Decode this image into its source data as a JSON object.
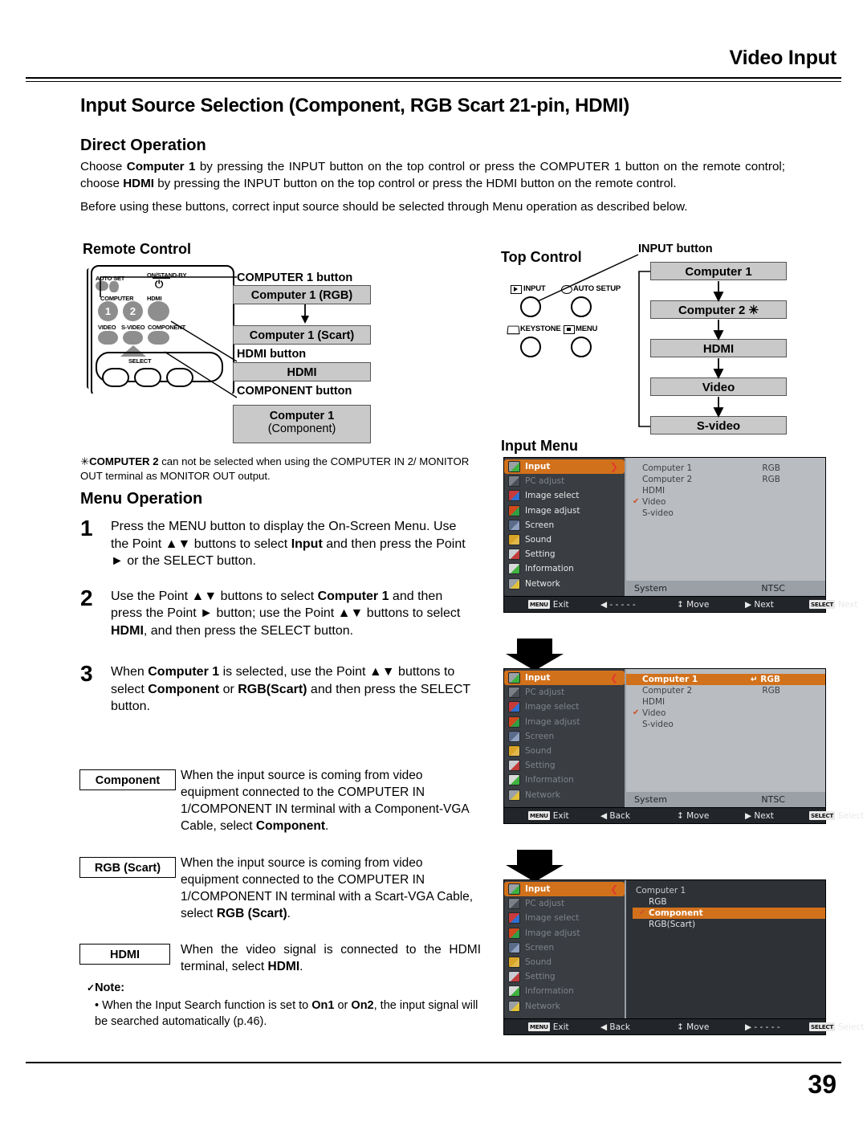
{
  "header": {
    "running_title": "Video Input"
  },
  "section": {
    "title": "Input Source Selection (Component, RGB Scart 21-pin, HDMI)",
    "direct_operation_heading": "Direct Operation",
    "direct_p1_a": "Choose ",
    "direct_p1_b": "Computer 1",
    "direct_p1_c": " by pressing the INPUT button on the top control or press the COMPUTER 1 button on the remote control; choose ",
    "direct_p1_d": "HDMI",
    "direct_p1_e": " by pressing the INPUT button on the top control or press the HDMI button on the remote control.",
    "direct_p2": "Before using these buttons, correct input source should be selected through Menu operation as described below."
  },
  "remote": {
    "heading": "Remote Control",
    "labels": {
      "auto_set": "AUTO SET",
      "on_standby": "ON/STAND-BY",
      "computer": "COMPUTER",
      "hdmi": "HDMI",
      "video": "VIDEO",
      "s_video": "S-VIDEO",
      "component": "COMPONENT",
      "select": "SELECT",
      "btn1": "1",
      "btn2": "2",
      "power_glyph": "⏻"
    },
    "callouts": {
      "computer1_button": "COMPUTER 1 button",
      "hdmi_button": "HDMI button",
      "component_button": "COMPONENT button"
    },
    "boxes": {
      "computer1_rgb": "Computer 1 (RGB)",
      "computer1_scart": "Computer 1 (Scart)",
      "hdmi": "HDMI",
      "computer1_component_line1": "Computer 1",
      "computer1_component_line2": "(Component)"
    }
  },
  "top_control": {
    "heading": "Top Control",
    "input_callout": "INPUT button",
    "buttons": [
      {
        "label": "INPUT"
      },
      {
        "label": "AUTO SETUP"
      },
      {
        "label": "KEYSTONE"
      },
      {
        "label": "MENU"
      }
    ],
    "cycle": [
      "Computer 1",
      "Computer 2 ✳",
      "HDMI",
      "Video",
      "S-video"
    ]
  },
  "footnote": {
    "marker": "✳",
    "bold": "COMPUTER 2",
    "rest": " can not be selected when using the COMPUTER IN 2/ MONITOR OUT terminal as MONITOR OUT output."
  },
  "menu_operation": {
    "heading": "Menu Operation",
    "steps": [
      {
        "num": "1",
        "text_parts": [
          {
            "t": "Press the MENU button to display the On-Screen Menu. Use the Point ▲▼ buttons to select ",
            "b": false
          },
          {
            "t": "Input",
            "b": true
          },
          {
            "t": " and then press the Point ► or the SELECT button.",
            "b": false
          }
        ]
      },
      {
        "num": "2",
        "text_parts": [
          {
            "t": "Use the Point ▲▼ buttons to select ",
            "b": false
          },
          {
            "t": "Computer 1",
            "b": true
          },
          {
            "t": " and then press the Point ► button; use the Point ▲▼ buttons to select ",
            "b": false
          },
          {
            "t": "HDMI",
            "b": true
          },
          {
            "t": ", and then press the SELECT button.",
            "b": false
          }
        ]
      },
      {
        "num": "3",
        "text_parts": [
          {
            "t": "When ",
            "b": false
          },
          {
            "t": "Computer 1",
            "b": true
          },
          {
            "t": " is selected, use the Point ▲▼ buttons to select ",
            "b": false
          },
          {
            "t": "Component",
            "b": true
          },
          {
            "t": " or ",
            "b": false
          },
          {
            "t": "RGB(Scart)",
            "b": true
          },
          {
            "t": " and then press the SELECT button.",
            "b": false
          }
        ]
      }
    ]
  },
  "definitions": [
    {
      "term": "Component",
      "text_parts": [
        {
          "t": "When the input source is coming from video equipment connected to the COMPUTER IN 1/COMPONENT IN terminal with a Component-VGA Cable, select ",
          "b": false
        },
        {
          "t": "Component",
          "b": true
        },
        {
          "t": ".",
          "b": false
        }
      ]
    },
    {
      "term": "RGB (Scart)",
      "text_parts": [
        {
          "t": "When the input source is coming from video equipment connected to the COMPUTER IN 1/COMPONENT IN terminal with a Scart-VGA Cable, select ",
          "b": false
        },
        {
          "t": "RGB (Scart)",
          "b": true
        },
        {
          "t": ".",
          "b": false
        }
      ]
    },
    {
      "term": "HDMI",
      "text_parts": [
        {
          "t": "When the video signal is connected to the HDMI terminal, select ",
          "b": false
        },
        {
          "t": "HDMI",
          "b": true
        },
        {
          "t": ".",
          "b": false
        }
      ]
    }
  ],
  "note": {
    "check": "✓",
    "heading": "Note:",
    "bullet": "•",
    "text_parts": [
      {
        "t": "When the Input Search function is set to ",
        "b": false
      },
      {
        "t": "On1",
        "b": true
      },
      {
        "t": " or ",
        "b": false
      },
      {
        "t": "On2",
        "b": true
      },
      {
        "t": ", the input signal will be searched automatically (p.46).",
        "b": false
      }
    ]
  },
  "input_menu": {
    "heading": "Input Menu",
    "sidebar": [
      {
        "label": "Input",
        "icon": "input-icon",
        "state": "selected"
      },
      {
        "label": "PC adjust",
        "icon": "pc-adjust-icon",
        "state": "dim"
      },
      {
        "label": "Image select",
        "icon": "image-select-icon",
        "state": "normal"
      },
      {
        "label": "Image adjust",
        "icon": "image-adjust-icon",
        "state": "normal"
      },
      {
        "label": "Screen",
        "icon": "screen-icon",
        "state": "normal"
      },
      {
        "label": "Sound",
        "icon": "sound-icon",
        "state": "normal"
      },
      {
        "label": "Setting",
        "icon": "setting-icon",
        "state": "normal"
      },
      {
        "label": "Information",
        "icon": "information-icon",
        "state": "normal"
      },
      {
        "label": "Network",
        "icon": "network-icon",
        "state": "normal"
      }
    ],
    "screens": [
      {
        "id": "screen-1",
        "side_arrow": "❯",
        "side_dim_all": false,
        "items": [
          {
            "label": "Computer 1",
            "value": "RGB",
            "check": false,
            "hl": false
          },
          {
            "label": "Computer 2",
            "value": "RGB",
            "check": false,
            "hl": false
          },
          {
            "label": "HDMI",
            "value": "",
            "check": false,
            "hl": false
          },
          {
            "label": "Video",
            "value": "",
            "check": true,
            "hl": false
          },
          {
            "label": "S-video",
            "value": "",
            "check": false,
            "hl": false
          }
        ],
        "system_label": "System",
        "system_value": "NTSC",
        "bar": [
          {
            "key": "MENU",
            "label": "Exit"
          },
          {
            "key": "",
            "label": "◀ - - - - -"
          },
          {
            "key": "",
            "label": "↕ Move"
          },
          {
            "key": "",
            "label": "▶ Next"
          },
          {
            "key": "SELECT",
            "label": "Next"
          }
        ]
      },
      {
        "id": "screen-2",
        "side_arrow": "❮",
        "side_dim_all": true,
        "items": [
          {
            "label": "Computer 1",
            "value": "RGB",
            "check": false,
            "hl": true,
            "enter": true
          },
          {
            "label": "Computer 2",
            "value": "RGB",
            "check": false,
            "hl": false
          },
          {
            "label": "HDMI",
            "value": "",
            "check": false,
            "hl": false
          },
          {
            "label": "Video",
            "value": "",
            "check": true,
            "hl": false
          },
          {
            "label": "S-video",
            "value": "",
            "check": false,
            "hl": false
          }
        ],
        "system_label": "System",
        "system_value": "NTSC",
        "bar": [
          {
            "key": "MENU",
            "label": "Exit"
          },
          {
            "key": "",
            "label": "◀ Back"
          },
          {
            "key": "",
            "label": "↕ Move"
          },
          {
            "key": "",
            "label": "▶ Next"
          },
          {
            "key": "SELECT",
            "label": "Select"
          }
        ]
      },
      {
        "id": "screen-3",
        "side_arrow": "❮",
        "side_dim_all": true,
        "sub_title": "Computer 1",
        "items": [
          {
            "label": "RGB",
            "value": "",
            "check": false,
            "hl": false
          },
          {
            "label": "Component",
            "value": "",
            "check": true,
            "hl": true
          },
          {
            "label": "RGB(Scart)",
            "value": "",
            "check": false,
            "hl": false
          }
        ],
        "bar": [
          {
            "key": "MENU",
            "label": "Exit"
          },
          {
            "key": "",
            "label": "◀ Back"
          },
          {
            "key": "",
            "label": "↕ Move"
          },
          {
            "key": "",
            "label": "▶ - - - - -"
          },
          {
            "key": "SELECT",
            "label": "Select"
          }
        ]
      }
    ]
  },
  "footer": {
    "page_number": "39"
  },
  "colors": {
    "osd_accent": "#d2711b",
    "osd_sidebar": "#3a3d42",
    "osd_panel_light": "#b9bcc0",
    "osd_panel_dark": "#2e3136",
    "box_gray": "#c9c9c9"
  }
}
